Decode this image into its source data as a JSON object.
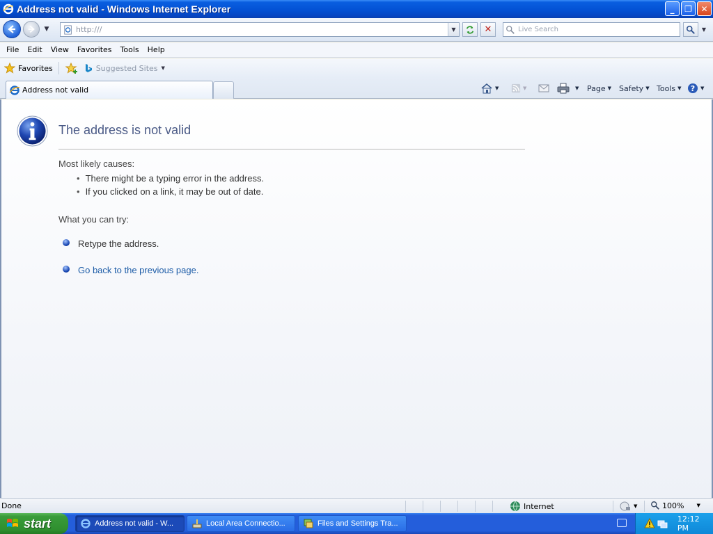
{
  "window": {
    "title": "Address not valid - Windows Internet Explorer",
    "minimize_label": "_",
    "maximize_label": "❐",
    "close_label": "✕"
  },
  "navbar": {
    "url": "http:///",
    "search_placeholder": "Live Search"
  },
  "menu": {
    "items": [
      "File",
      "Edit",
      "View",
      "Favorites",
      "Tools",
      "Help"
    ]
  },
  "favbar": {
    "favorites_label": "Favorites",
    "suggested_label": "Suggested Sites"
  },
  "tabs": {
    "active_label": "Address not valid"
  },
  "command_bar": {
    "page_label": "Page",
    "safety_label": "Safety",
    "tools_label": "Tools"
  },
  "content": {
    "title": "The address is not valid",
    "causes_heading": "Most likely causes:",
    "causes": [
      "There might be a typing error in the address.",
      "If you clicked on a link, it may be out of date."
    ],
    "try_heading": "What you can try:",
    "try_items": [
      "Retype the address.",
      "Go back to the previous page."
    ]
  },
  "statusbar": {
    "status": "Done",
    "zone": "Internet",
    "zoom": "100%"
  },
  "taskbar": {
    "start_label": "start",
    "tasks": [
      "Address not valid - W...",
      "Local Area Connectio...",
      "Files and Settings Tra..."
    ],
    "clock": "12:12 PM"
  },
  "colors": {
    "title_text": "#4a5a86",
    "link": "#1d5ca7",
    "taskbar_blue": "#245edb",
    "start_green": "#3a9c3a"
  }
}
